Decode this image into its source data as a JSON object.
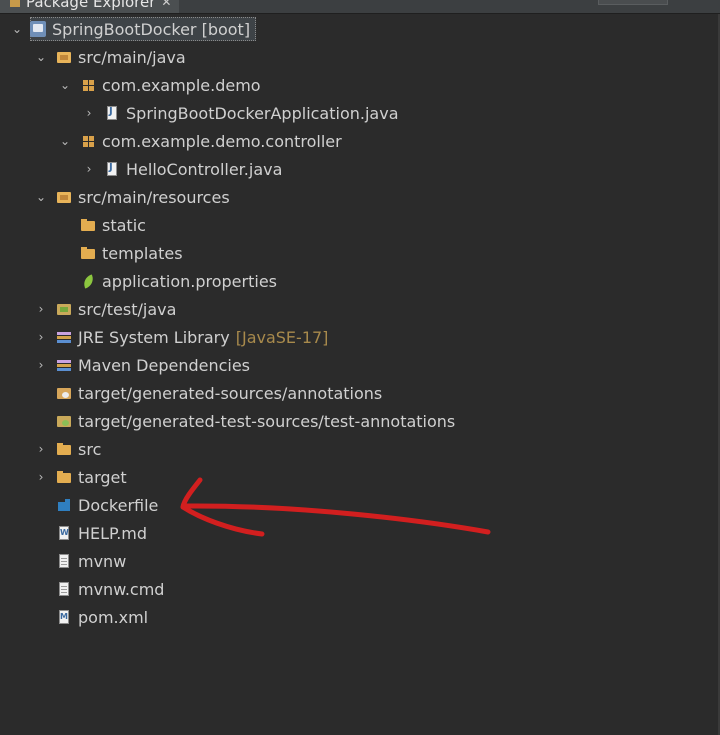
{
  "view": {
    "tab_title": "Package Explorer",
    "close_glyph": "✕"
  },
  "colors": {
    "background": "#2b2b2b",
    "text": "#d0d0d0",
    "decoration": "#a88a4c",
    "annotation_arrow": "#d21f1f"
  },
  "tree": {
    "project": {
      "label": "SpringBootDocker [boot]"
    },
    "src_main_java": {
      "label": "src/main/java"
    },
    "pkg_demo": {
      "label": "com.example.demo"
    },
    "app_java": {
      "label": "SpringBootDockerApplication.java"
    },
    "pkg_controller": {
      "label": "com.example.demo.controller"
    },
    "hello_java": {
      "label": "HelloController.java"
    },
    "src_main_resources": {
      "label": "src/main/resources"
    },
    "static": {
      "label": "static"
    },
    "templates": {
      "label": "templates"
    },
    "app_props": {
      "label": "application.properties"
    },
    "src_test_java": {
      "label": "src/test/java"
    },
    "jre": {
      "label": "JRE System Library",
      "decoration": "[JavaSE-17]"
    },
    "maven": {
      "label": "Maven Dependencies"
    },
    "gen_sources": {
      "label": "target/generated-sources/annotations"
    },
    "gen_test_sources": {
      "label": "target/generated-test-sources/test-annotations"
    },
    "src": {
      "label": "src"
    },
    "target": {
      "label": "target"
    },
    "dockerfile": {
      "label": "Dockerfile"
    },
    "help_md": {
      "label": "HELP.md"
    },
    "mvnw": {
      "label": "mvnw"
    },
    "mvnw_cmd": {
      "label": "mvnw.cmd"
    },
    "pom": {
      "label": "pom.xml"
    }
  },
  "icons": {
    "project": "project-icon",
    "source_folder": "source-folder-icon",
    "package": "package-icon",
    "java_file": "java-file-icon",
    "folder": "folder-icon",
    "properties": "spring-leaf-icon",
    "library": "library-icon",
    "dockerfile": "docker-icon",
    "markdown": "markdown-file-icon",
    "text_file": "text-file-icon",
    "pom": "maven-pom-icon"
  }
}
